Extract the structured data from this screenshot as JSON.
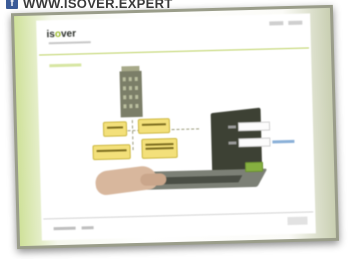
{
  "caption": {
    "social_icon": "facebook-icon",
    "social_glyph": "f",
    "url_text": "WWW.ISOVER.EXPERT"
  },
  "app": {
    "logo_prefix": "is",
    "logo_accent": "o",
    "logo_suffix": "ver"
  },
  "colors": {
    "brand_green": "#9bbb2a",
    "button_green": "#86b040",
    "diagram_yellow": "#f3e07a",
    "facebook_blue": "#3b5b98"
  }
}
